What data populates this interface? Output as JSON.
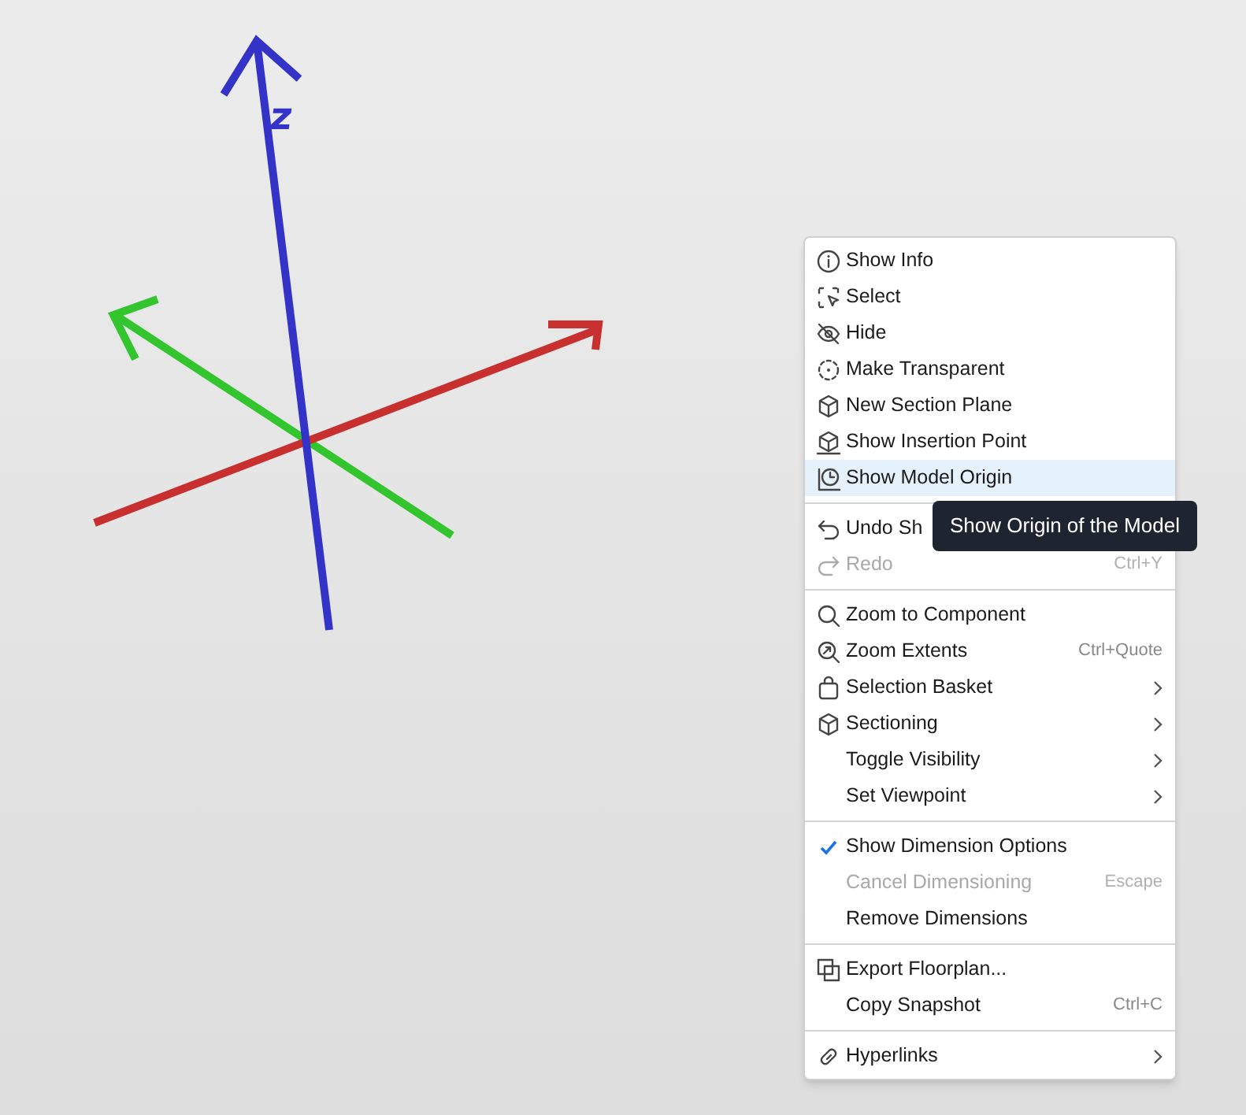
{
  "viewport": {
    "axis_label": "z"
  },
  "context_menu": {
    "sections": [
      [
        {
          "label": "Show Info",
          "selected": false,
          "disabled": false,
          "checked": false,
          "submenu": false
        },
        {
          "label": "Select",
          "selected": false,
          "disabled": false,
          "checked": false,
          "submenu": false
        },
        {
          "label": "Hide",
          "selected": false,
          "disabled": false,
          "checked": false,
          "submenu": false
        },
        {
          "label": "Make Transparent",
          "selected": false,
          "disabled": false,
          "checked": false,
          "submenu": false
        },
        {
          "label": "New Section Plane",
          "selected": false,
          "disabled": false,
          "checked": false,
          "submenu": false
        },
        {
          "label": "Show Insertion Point",
          "selected": false,
          "disabled": false,
          "checked": false,
          "submenu": false
        },
        {
          "label": "Show Model Origin",
          "selected": true,
          "disabled": false,
          "checked": false,
          "submenu": false
        }
      ],
      [
        {
          "label": "Undo Sh",
          "selected": false,
          "disabled": false,
          "checked": false,
          "submenu": false
        },
        {
          "label": "Redo",
          "shortcut": "Ctrl+Y",
          "selected": false,
          "disabled": true,
          "checked": false,
          "submenu": false
        }
      ],
      [
        {
          "label": "Zoom to Component",
          "selected": false,
          "disabled": false,
          "checked": false,
          "submenu": false
        },
        {
          "label": "Zoom Extents",
          "shortcut": "Ctrl+Quote",
          "selected": false,
          "disabled": false,
          "checked": false,
          "submenu": false
        },
        {
          "label": "Selection Basket",
          "selected": false,
          "disabled": false,
          "checked": false,
          "submenu": true
        },
        {
          "label": "Sectioning",
          "selected": false,
          "disabled": false,
          "checked": false,
          "submenu": true
        },
        {
          "label": "Toggle Visibility",
          "selected": false,
          "disabled": false,
          "checked": false,
          "submenu": true
        },
        {
          "label": "Set Viewpoint",
          "selected": false,
          "disabled": false,
          "checked": false,
          "submenu": true
        }
      ],
      [
        {
          "label": "Show Dimension Options",
          "selected": false,
          "disabled": false,
          "checked": true,
          "submenu": false
        },
        {
          "label": "Cancel Dimensioning",
          "shortcut": "Escape",
          "selected": false,
          "disabled": true,
          "checked": false,
          "submenu": false
        },
        {
          "label": "Remove Dimensions",
          "selected": false,
          "disabled": false,
          "checked": false,
          "submenu": false
        }
      ],
      [
        {
          "label": "Export Floorplan...",
          "selected": false,
          "disabled": false,
          "checked": false,
          "submenu": false
        },
        {
          "label": "Copy Snapshot",
          "shortcut": "Ctrl+C",
          "selected": false,
          "disabled": false,
          "checked": false,
          "submenu": false
        }
      ],
      [
        {
          "label": "Hyperlinks",
          "selected": false,
          "disabled": false,
          "checked": false,
          "submenu": true
        }
      ]
    ]
  },
  "tooltip": {
    "text": "Show Origin of the Model"
  }
}
